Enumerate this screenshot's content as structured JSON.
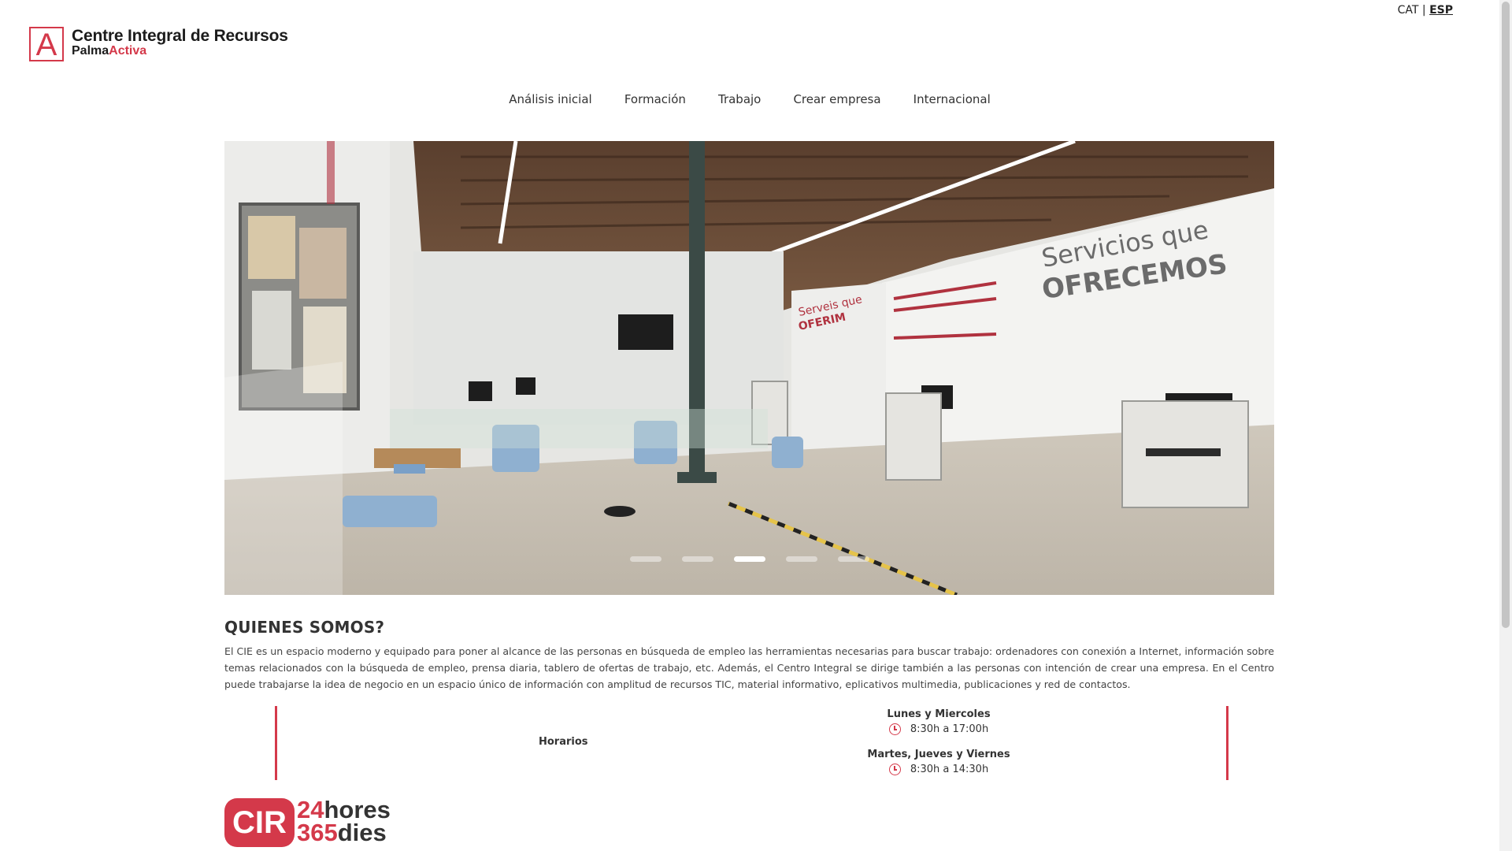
{
  "brand": {
    "mark": "A",
    "title": "Centre Integral de Recursos",
    "sub_primary": "Palma",
    "sub_accent": "Activa",
    "color": "#d4394a"
  },
  "lang": {
    "cat": "CAT",
    "sep": "|",
    "esp": "ESP",
    "active": "ESP"
  },
  "nav": {
    "items": [
      {
        "label": "Análisis inicial"
      },
      {
        "label": "Formación"
      },
      {
        "label": "Trabajo"
      },
      {
        "label": "Crear empresa"
      },
      {
        "label": "Internacional"
      }
    ]
  },
  "hero": {
    "wall_title_1": "Servicios que",
    "wall_title_2": "OFRECEMOS",
    "panel_1": "Serveis que",
    "panel_2": "OFERIM",
    "slides": 5,
    "active_slide": 3
  },
  "about": {
    "heading": "QUIENES SOMOS?",
    "text": "El CIE es un espacio moderno y equipado para poner al alcance de las personas en búsqueda de empleo las herramientas necesarias para buscar trabajo: ordenadores con conexión a Internet, información sobre temas relacionados con la búsqueda de empleo, prensa diaria, tablero de ofertas de trabajo, etc. Además, el Centro Integral se dirige también a las personas con intención de crear una empresa. En el Centro puede trabajarse la idea de negocio en un espacio único de información con amplitud de recursos TIC, material informativo, eplicativos multimedia, publicaciones y red de contactos."
  },
  "hours": {
    "label": "Horarios",
    "blocks": [
      {
        "day": "Lunes y Miercoles",
        "time": "8:30h a 17:00h"
      },
      {
        "day": "Martes, Jueves y Viernes",
        "time": "8:30h a 14:30h"
      }
    ]
  },
  "cir": {
    "box": "CIR",
    "n1": "24",
    "w1": "hores",
    "n2": "365",
    "w2": "dies"
  }
}
